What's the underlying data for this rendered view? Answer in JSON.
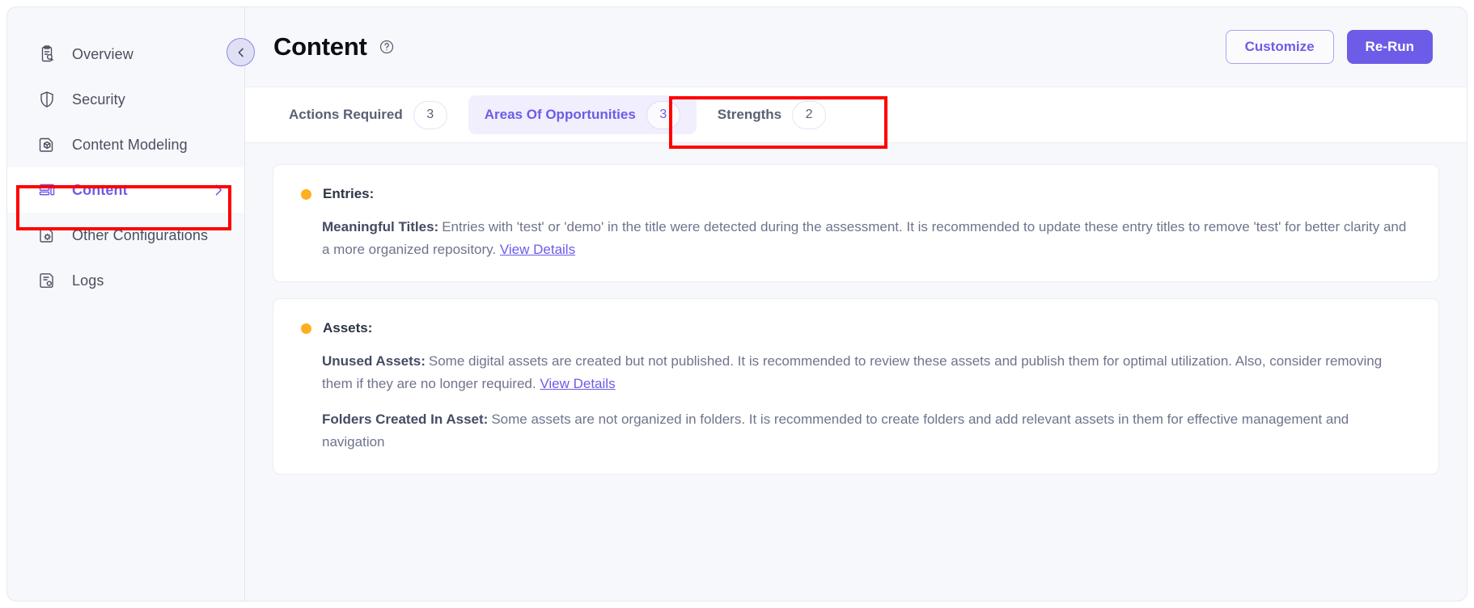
{
  "sidebar": {
    "items": [
      {
        "label": "Overview",
        "icon": "clipboard-search-icon",
        "active": false,
        "chevron": false
      },
      {
        "label": "Security",
        "icon": "shield-icon",
        "active": false,
        "chevron": false
      },
      {
        "label": "Content Modeling",
        "icon": "document-cube-icon",
        "active": false,
        "chevron": false
      },
      {
        "label": "Content",
        "icon": "content-list-icon",
        "active": true,
        "chevron": true
      },
      {
        "label": "Other Configurations",
        "icon": "document-gear-icon",
        "active": false,
        "chevron": false
      },
      {
        "label": "Logs",
        "icon": "document-log-icon",
        "active": false,
        "chevron": false
      }
    ]
  },
  "header": {
    "title": "Content",
    "help_icon": "question-circle-icon",
    "collapse_icon": "chevron-left-icon",
    "customize_label": "Customize",
    "rerun_label": "Re-Run"
  },
  "tabs": [
    {
      "label": "Actions Required",
      "count": "3",
      "active": false
    },
    {
      "label": "Areas Of Opportunities",
      "count": "3",
      "active": true
    },
    {
      "label": "Strengths",
      "count": "2",
      "active": false
    }
  ],
  "cards": [
    {
      "heading": "Entries:",
      "status_color": "#ffae1f",
      "items": [
        {
          "label": "Meaningful Titles:",
          "text": "Entries with 'test' or 'demo' in the title were detected during the assessment. It is recommended to update these entry titles to remove 'test' for better clarity and a more organized repository.",
          "link": "View Details"
        }
      ]
    },
    {
      "heading": "Assets:",
      "status_color": "#ffae1f",
      "items": [
        {
          "label": "Unused Assets:",
          "text": "Some digital assets are created but not published. It is recommended to review these assets and publish them for optimal utilization. Also, consider removing them if they are no longer required.",
          "link": "View Details"
        },
        {
          "label": "Folders Created In Asset:",
          "text": "Some assets are not organized in folders. It is recommended to create folders and add relevant assets in them for effective management and navigation",
          "link": ""
        }
      ]
    }
  ],
  "colors": {
    "accent": "#6c5ce7",
    "status_warning": "#ffae1f",
    "highlight_box": "#ff0000",
    "panel_bg": "#f7f8fc"
  }
}
